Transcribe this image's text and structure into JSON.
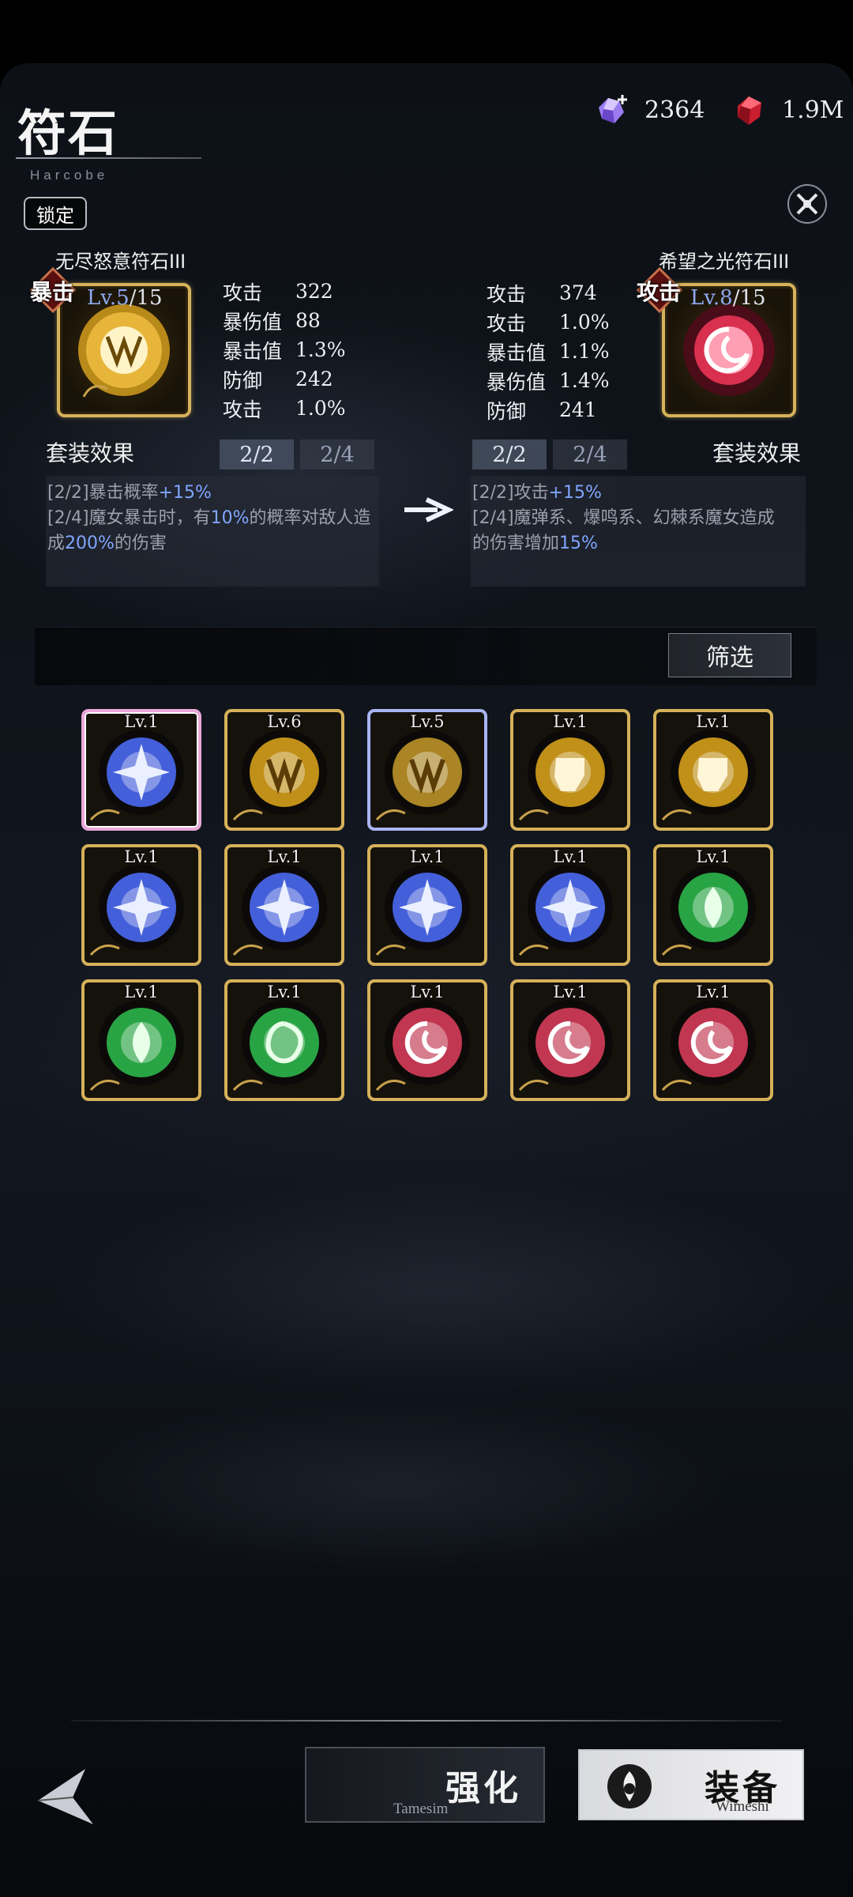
{
  "header": {
    "title": "符石",
    "subtitle": "Harcobe",
    "lock_label": "锁定",
    "currency": [
      {
        "icon": "purple-crystal-plus-icon",
        "value": "2364"
      },
      {
        "icon": "red-crystal-icon",
        "value": "1.9M"
      }
    ]
  },
  "current_rune": {
    "name": "无尽怒意符石III",
    "type_tag": "暴击",
    "level_current": "Lv.5",
    "level_max": "/15",
    "icon": "golden-fang-rune-icon",
    "stats": [
      {
        "label": "攻击",
        "value": "322"
      },
      {
        "label": "暴伤值",
        "value": "88"
      },
      {
        "label": "暴击值",
        "value": "1.3%"
      },
      {
        "label": "防御",
        "value": "242"
      },
      {
        "label": "攻击",
        "value": "1.0%"
      }
    ],
    "set": {
      "title": "套装效果",
      "tabs": [
        "2/2",
        "2/4"
      ],
      "effects": [
        {
          "prefix": "[2/2]暴击概率",
          "hl": "+15%",
          "suffix": ""
        },
        {
          "prefix": "[2/4]魔女暴击时，有",
          "hl": "10%",
          "suffix": "的概率对敌人造"
        },
        {
          "prefix": "成",
          "hl": "200%",
          "suffix": "的伤害"
        }
      ]
    }
  },
  "target_rune": {
    "name": "希望之光符石III",
    "type_tag": "攻击",
    "level_current": "Lv.8",
    "level_max": "/15",
    "icon": "red-swirl-rune-icon",
    "stats": [
      {
        "label": "攻击",
        "value": "374"
      },
      {
        "label": "攻击",
        "value": "1.0%"
      },
      {
        "label": "暴击值",
        "value": "1.1%"
      },
      {
        "label": "暴伤值",
        "value": "1.4%"
      },
      {
        "label": "防御",
        "value": "241"
      }
    ],
    "set": {
      "title": "套装效果",
      "tabs": [
        "2/2",
        "2/4"
      ],
      "effects": [
        {
          "prefix": "[2/2]攻击",
          "hl": "+15%",
          "suffix": ""
        },
        {
          "prefix": "[2/4]魔弹系、爆鸣系、幻棘系魔女造成",
          "hl": "",
          "suffix": ""
        },
        {
          "prefix": "的伤害增加",
          "hl": "15%",
          "suffix": ""
        }
      ]
    }
  },
  "filter_label": "筛选",
  "inventory": [
    {
      "level": "Lv.1",
      "icon": "blue-star-rune-icon",
      "color": "#4f6fff",
      "state": "selected-pink"
    },
    {
      "level": "Lv.6",
      "icon": "golden-fang-rune-icon",
      "color": "#e0a81c",
      "state": ""
    },
    {
      "level": "Lv.5",
      "icon": "golden-fang-rune-icon",
      "color": "#c79a2a",
      "state": "selected-blue"
    },
    {
      "level": "Lv.1",
      "icon": "golden-fist-rune-icon",
      "color": "#e0a81c",
      "state": ""
    },
    {
      "level": "Lv.1",
      "icon": "golden-fist-rune-icon",
      "color": "#e0a81c",
      "state": ""
    },
    {
      "level": "Lv.1",
      "icon": "blue-star-rune-icon",
      "color": "#4f6fff",
      "state": ""
    },
    {
      "level": "Lv.1",
      "icon": "blue-star-rune-icon",
      "color": "#4f6fff",
      "state": ""
    },
    {
      "level": "Lv.1",
      "icon": "blue-star-rune-icon",
      "color": "#4f6fff",
      "state": ""
    },
    {
      "level": "Lv.1",
      "icon": "blue-star-rune-icon",
      "color": "#4f6fff",
      "state": ""
    },
    {
      "level": "Lv.1",
      "icon": "green-drop-rune-icon",
      "color": "#2fbf4f",
      "state": ""
    },
    {
      "level": "Lv.1",
      "icon": "green-drop-rune-icon",
      "color": "#2fbf4f",
      "state": ""
    },
    {
      "level": "Lv.1",
      "icon": "green-swirl-rune-icon",
      "color": "#2fbf4f",
      "state": ""
    },
    {
      "level": "Lv.1",
      "icon": "red-swirl-rune-icon",
      "color": "#e2405e",
      "state": ""
    },
    {
      "level": "Lv.1",
      "icon": "red-swirl-rune-icon",
      "color": "#e2405e",
      "state": ""
    },
    {
      "level": "Lv.1",
      "icon": "red-swirl-rune-icon",
      "color": "#e2405e",
      "state": ""
    }
  ],
  "actions": {
    "upgrade_label": "强化",
    "upgrade_sub": "Tamesim",
    "equip_label": "装备",
    "equip_sub": "Wimeshi"
  }
}
